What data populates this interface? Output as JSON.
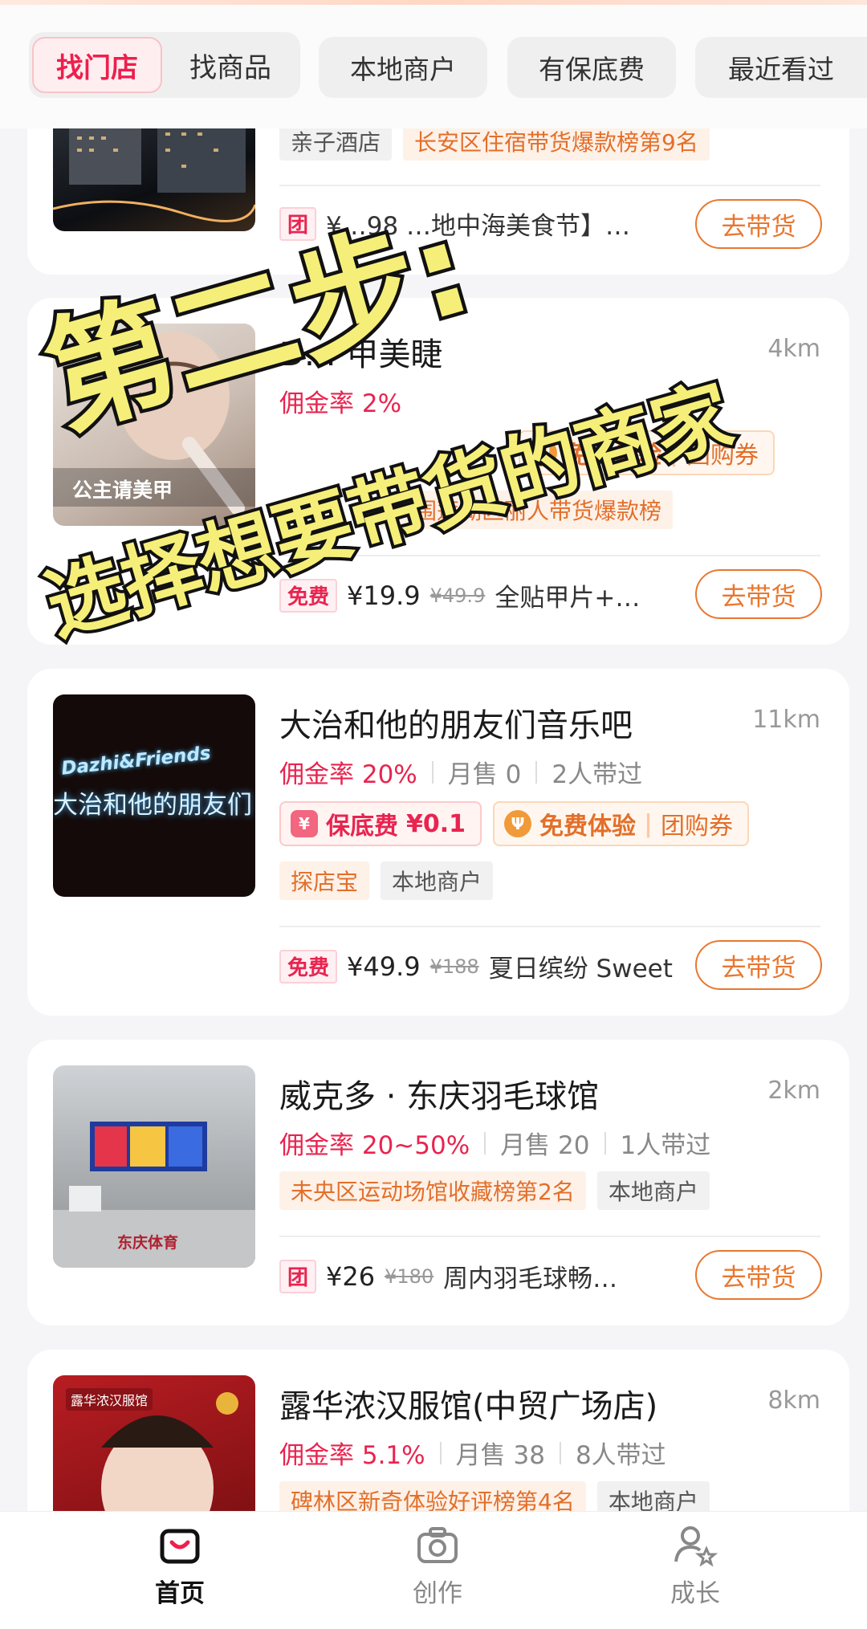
{
  "top_tabs": {
    "active": "找门店",
    "second": "找商品",
    "chips": [
      "本地商户",
      "有保底费",
      "最近看过"
    ]
  },
  "overlay": {
    "line1": "第二步:",
    "line2": "选择想要带货的商家"
  },
  "cards": [
    {
      "tags": [
        "亲子酒店",
        "长安区住宿带货爆款榜第9名"
      ],
      "deal_badge": "团",
      "deal_text": "¥…98 …地中海美食节】…",
      "button": "去带货"
    },
    {
      "title": "D… 甲美睫",
      "distance": "4km",
      "rate": "佣金率 2%",
      "pill_orange_1": "免费体验",
      "pill_orange_2": "团购券",
      "tags": [
        "入围莲湖区丽人带货爆款榜"
      ],
      "thumb_text": "公主请美甲",
      "deal_badge": "免费",
      "price": "¥19.9",
      "old_price": "¥49.9",
      "deal_text": "全贴甲片+…",
      "button": "去带货"
    },
    {
      "title": "大治和他的朋友们音乐吧",
      "distance": "11km",
      "rate": "佣金率 20%",
      "monthly": "月售 0",
      "promoters": "2人带过",
      "pill_red_icon": "¥",
      "pill_red_1": "保底费",
      "pill_red_2": "¥0.1",
      "pill_orange_1": "免费体验",
      "pill_orange_2": "团购券",
      "tags": [
        "探店宝",
        "本地商户"
      ],
      "thumb_text_1": "Dazhi&Friends",
      "thumb_text_2": "大治和他的朋友们",
      "deal_badge": "免费",
      "price": "¥49.9",
      "old_price": "¥188",
      "deal_text": "夏日缤纷 Sweet",
      "button": "去带货"
    },
    {
      "title": "威克多 · 东庆羽毛球馆",
      "distance": "2km",
      "rate": "佣金率 20~50%",
      "monthly": "月售 20",
      "promoters": "1人带过",
      "tags": [
        "未央区运动场馆收藏榜第2名",
        "本地商户"
      ],
      "thumb_text": "东庆体育",
      "deal_badge": "团",
      "price": "¥26",
      "old_price": "¥180",
      "deal_text": "周内羽毛球畅…",
      "button": "去带货"
    },
    {
      "title": "露华浓汉服馆(中贸广场店)",
      "distance": "8km",
      "rate": "佣金率 5.1%",
      "monthly": "月售 38",
      "promoters": "8人带过",
      "tags": [
        "碑林区新奇体验好评榜第4名",
        "本地商户"
      ],
      "thumb_text": "露华浓汉服馆"
    }
  ],
  "bottom_nav": [
    "首页",
    "创作",
    "成长"
  ],
  "colors": {
    "accent_red": "#e8244f",
    "accent_orange": "#e8772f",
    "overlay_yellow": "#f5ef7a"
  }
}
